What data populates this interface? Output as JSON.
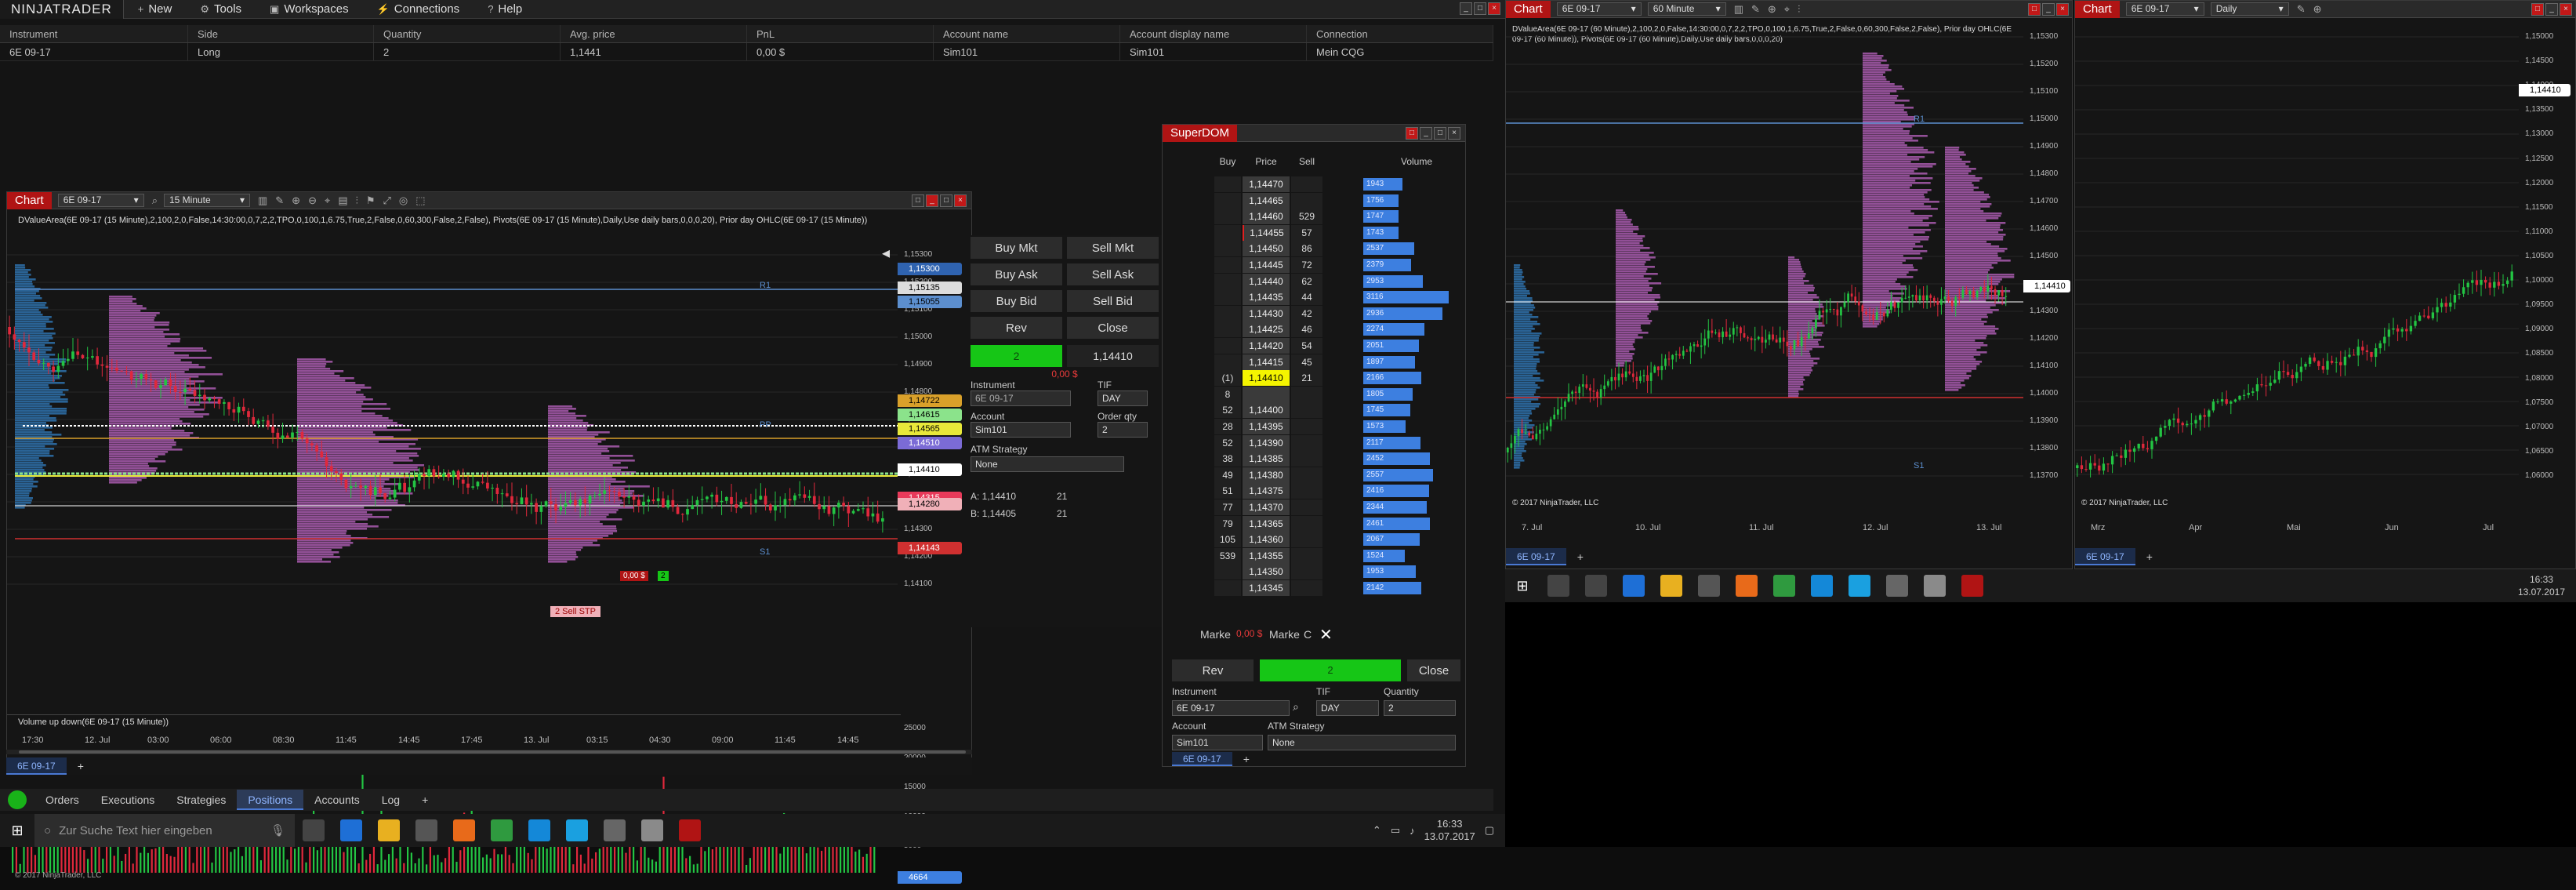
{
  "control_center": {
    "logo": "NINJATRADER",
    "menu": [
      {
        "icon": "+",
        "label": "New"
      },
      {
        "icon": "⚙",
        "label": "Tools"
      },
      {
        "icon": "▣",
        "label": "Workspaces"
      },
      {
        "icon": "⚡",
        "label": "Connections"
      },
      {
        "icon": "?",
        "label": "Help"
      }
    ]
  },
  "positions": {
    "headers": [
      "Instrument",
      "Side",
      "Quantity",
      "Avg. price",
      "PnL",
      "Account name",
      "Account display name",
      "Connection"
    ],
    "rows": [
      [
        "6E 09-17",
        "Long",
        "2",
        "1,1441",
        "0,00 $",
        "Sim101",
        "Sim101",
        "Mein CQG"
      ]
    ]
  },
  "chart1": {
    "label": "Chart",
    "instrument": "6E 09-17",
    "interval": "15 Minute",
    "indicator_line": "DValueArea(6E 09-17 (15 Minute),2,100,2,0,False,14:30:00,0,7,2,2,TPO,0,100,1,6.75,True,2,False,0,60,300,False,2,False), Pivots(6E 09-17 (15 Minute),Daily,Use daily bars,0,0,0,20), Prior day OHLC(6E 09-17 (15 Minute))",
    "price_ticks": [
      "1,15300",
      "1,15200",
      "1,15100",
      "1,15000",
      "1,14900",
      "1,14800",
      "1,14700",
      "1,14600",
      "1,14500",
      "1,14400",
      "1,14300",
      "1,14200",
      "1,14100"
    ],
    "price_labels": [
      {
        "text": "1,15300",
        "color": "#2f63b0"
      },
      {
        "text": "1,15135",
        "color": "#dddddd"
      },
      {
        "text": "1,15055",
        "color": "#5c8fcf"
      },
      {
        "text": "1,14722",
        "color": "#d9a02a"
      },
      {
        "text": "1,14615",
        "color": "#8be38b"
      },
      {
        "text": "1,14565",
        "color": "#e8e83a"
      },
      {
        "text": "1,14510",
        "color": "#7b6bd6"
      },
      {
        "text": "1,14410",
        "color": "#ffffff"
      },
      {
        "text": "1,14315",
        "color": "#e83a5a"
      },
      {
        "text": "1,14280",
        "color": "#f0b0b8"
      },
      {
        "text": "1,14143",
        "color": "#d03030"
      }
    ],
    "pivot_labels": [
      "R1",
      "PP",
      "S1"
    ],
    "order_label": "2  Sell STP",
    "pnl_flag": "0,00 $",
    "qty_flag": "2",
    "volume_title": "Volume up down(6E 09-17 (15 Minute))",
    "volume_ticks": [
      "25000",
      "20000",
      "15000",
      "10000",
      "5000"
    ],
    "volume_label": "4664",
    "copyright": "© 2017 NinjaTrader, LLC",
    "time_ticks": [
      "17:30",
      "12. Jul",
      "03:00",
      "06:00",
      "08:30",
      "11:45",
      "14:45",
      "17:45",
      "13. Jul",
      "03:15",
      "04:30",
      "09:00",
      "11:45",
      "14:45"
    ],
    "tab": "6E 09-17"
  },
  "chart_trader": {
    "buy_mkt": "Buy Mkt",
    "sell_mkt": "Sell Mkt",
    "buy_ask": "Buy Ask",
    "sell_ask": "Sell Ask",
    "buy_bid": "Buy Bid",
    "sell_bid": "Sell Bid",
    "rev": "Rev",
    "close": "Close",
    "position_qty": "2",
    "avg_price": "1,14410",
    "pnl": "0,00 $",
    "instrument_label": "Instrument",
    "instrument_value": "6E 09-17",
    "tif_label": "TIF",
    "tif_value": "DAY",
    "account_label": "Account",
    "account_value": "Sim101",
    "qty_label": "Order qty",
    "qty_value": "2",
    "atm_label": "ATM Strategy",
    "atm_value": "None",
    "a_line": "A: 1,14410",
    "a_qty": "21",
    "b_line": "B: 1,14405",
    "b_qty": "21"
  },
  "superdom": {
    "title": "SuperDOM",
    "headers": [
      "Buy",
      "Price",
      "Sell",
      "",
      "Volume"
    ],
    "rows": [
      {
        "buy": "",
        "price": "1,14470",
        "sell": "",
        "vol": "1943",
        "vpct": 0.42
      },
      {
        "buy": "",
        "price": "1,14465",
        "sell": "",
        "vol": "1756",
        "vpct": 0.38
      },
      {
        "buy": "",
        "price": "1,14460",
        "sell": "529",
        "vol": "1747",
        "vpct": 0.38
      },
      {
        "buy": "",
        "price": "1,14455",
        "sell": "57",
        "vol": "1743",
        "vpct": 0.38
      },
      {
        "buy": "",
        "price": "1,14450",
        "sell": "86",
        "vol": "2537",
        "vpct": 0.55
      },
      {
        "buy": "",
        "price": "1,14445",
        "sell": "72",
        "vol": "2379",
        "vpct": 0.52
      },
      {
        "buy": "",
        "price": "1,14440",
        "sell": "62",
        "vol": "2953",
        "vpct": 0.64
      },
      {
        "buy": "",
        "price": "1,14435",
        "sell": "44",
        "vol": "3116",
        "vpct": 0.92
      },
      {
        "buy": "",
        "price": "1,14430",
        "sell": "42",
        "vol": "2936",
        "vpct": 0.86
      },
      {
        "buy": "",
        "price": "1,14425",
        "sell": "46",
        "vol": "2274",
        "vpct": 0.66
      },
      {
        "buy": "",
        "price": "1,14420",
        "sell": "54",
        "vol": "2051",
        "vpct": 0.6
      },
      {
        "buy": "",
        "price": "1,14415",
        "sell": "45",
        "vol": "1897",
        "vpct": 0.56
      },
      {
        "buy": "(1)",
        "price": "1,14410",
        "sell": "21",
        "vol": "2166",
        "vpct": 0.63
      },
      {
        "buy": "8",
        "price": "",
        "sell": "",
        "vol": "1805",
        "vpct": 0.53
      },
      {
        "buy": "52",
        "price": "1,14400",
        "sell": "",
        "vol": "1745",
        "vpct": 0.51
      },
      {
        "buy": "28",
        "price": "1,14395",
        "sell": "",
        "vol": "1573",
        "vpct": 0.46
      },
      {
        "buy": "52",
        "price": "1,14390",
        "sell": "",
        "vol": "2117",
        "vpct": 0.62
      },
      {
        "buy": "38",
        "price": "1,14385",
        "sell": "",
        "vol": "2452",
        "vpct": 0.72
      },
      {
        "buy": "49",
        "price": "1,14380",
        "sell": "",
        "vol": "2557",
        "vpct": 0.75
      },
      {
        "buy": "51",
        "price": "1,14375",
        "sell": "",
        "vol": "2416",
        "vpct": 0.71
      },
      {
        "buy": "77",
        "price": "1,14370",
        "sell": "",
        "vol": "2344",
        "vpct": 0.69
      },
      {
        "buy": "79",
        "price": "1,14365",
        "sell": "",
        "vol": "2461",
        "vpct": 0.72
      },
      {
        "buy": "105",
        "price": "1,14360",
        "sell": "",
        "vol": "2067",
        "vpct": 0.61
      },
      {
        "buy": "539",
        "price": "1,14355",
        "sell": "",
        "vol": "1524",
        "vpct": 0.45
      },
      {
        "buy": "",
        "price": "1,14350",
        "sell": "",
        "vol": "1953",
        "vpct": 0.57
      },
      {
        "buy": "",
        "price": "1,14345",
        "sell": "",
        "vol": "2142",
        "vpct": 0.63
      }
    ],
    "marker_left": "Marke",
    "marker_pnl": "0,00 $",
    "marker_right": "Marke",
    "c_label": "C",
    "rev": "Rev",
    "position_qty": "2",
    "close": "Close",
    "instrument_label": "Instrument",
    "instrument_value": "6E 09-17",
    "tif_label": "TIF",
    "tif_value": "DAY",
    "qty_label": "Quantity",
    "qty_value": "2",
    "account_label": "Account",
    "account_value": "Sim101",
    "atm_label": "ATM Strategy",
    "atm_value": "None",
    "tab": "6E 09-17"
  },
  "bottom_tabs": [
    "Orders",
    "Executions",
    "Strategies",
    "Positions",
    "Accounts",
    "Log"
  ],
  "active_bottom_tab": "Positions",
  "taskbar1": {
    "search_placeholder": "Zur Suche Text hier eingeben",
    "time": "16:33",
    "date": "13.07.2017"
  },
  "chart2": {
    "label": "Chart",
    "instrument": "6E 09-17",
    "interval": "60 Minute",
    "indicator_line": "DValueArea(6E 09-17 (60 Minute),2,100,2,0,False,14:30:00,0,7,2,2,TPO,0,100,1,6.75,True,2,False,0,60,300,False,2,False), Prior day OHLC(6E 09-17 (60 Minute)), Pivots(6E 09-17 (60 Minute),Daily,Use daily bars,0,0,0,20)",
    "price_ticks": [
      "1,15300",
      "1,15200",
      "1,15100",
      "1,15000",
      "1,14900",
      "1,14800",
      "1,14700",
      "1,14600",
      "1,14500",
      "1,14400",
      "1,14300",
      "1,14200",
      "1,14100",
      "1,14000",
      "1,13900",
      "1,13800",
      "1,13700"
    ],
    "price_label": "1,14410",
    "pivot_labels": [
      "R1",
      "S1"
    ],
    "time_ticks": [
      "7. Jul",
      "10. Jul",
      "11. Jul",
      "12. Jul",
      "13. Jul"
    ],
    "copyright": "© 2017 NinjaTrader, LLC",
    "tab": "6E 09-17"
  },
  "chart3": {
    "label": "Chart",
    "instrument": "6E 09-17",
    "interval": "Daily",
    "price_ticks": [
      "1,15000",
      "1,14500",
      "1,14000",
      "1,13500",
      "1,13000",
      "1,12500",
      "1,12000",
      "1,11500",
      "1,11000",
      "1,10500",
      "1,10000",
      "1,09500",
      "1,09000",
      "1,08500",
      "1,08000",
      "1,07500",
      "1,07000",
      "1,06500",
      "1,06000"
    ],
    "price_label": "1,14410",
    "time_ticks": [
      "Mrz",
      "Apr",
      "Mai",
      "Jun",
      "Jul"
    ],
    "copyright": "© 2017 NinjaTrader, LLC",
    "tab": "6E 09-17"
  },
  "taskbar2": {
    "time": "16:33",
    "date": "13.07.2017"
  }
}
